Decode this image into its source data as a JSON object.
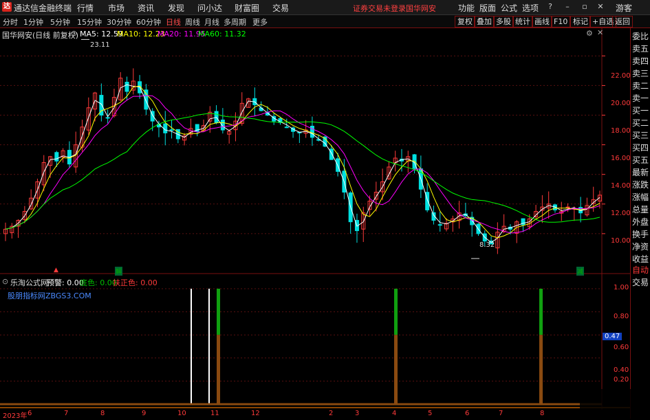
{
  "menubar": {
    "app_title": "通达信金融终端",
    "items": [
      "行情",
      "市场",
      "资讯",
      "发现",
      "问小达",
      "财富圈",
      "交易"
    ],
    "warning": "证券交易未登录",
    "stock": "国华网安",
    "right_items": [
      "功能",
      "版面",
      "公式",
      "选项"
    ],
    "guest": "游客"
  },
  "periodbar": {
    "periods": [
      "分时",
      "1分钟",
      "5分钟",
      "15分钟",
      "30分钟",
      "60分钟",
      "日线",
      "周线",
      "月线",
      "多周期",
      "更多"
    ],
    "active": "日线",
    "tools": [
      "复权",
      "叠加",
      "多股",
      "统计",
      "画线",
      "F10",
      "标记",
      "+自选",
      "返回"
    ]
  },
  "main_chart": {
    "title": "国华网安(日线 前复权)",
    "ma5": "MA5: 12.59",
    "ma10": "MA10: 12.23",
    "ma20": "MA20: 11.95",
    "ma60": "MA60: 11.32",
    "high_label": "23.11",
    "low_label": "8.32",
    "marker_jie": "解",
    "marker_jian": "减"
  },
  "sub_chart": {
    "name": "乐淘公式网",
    "signal": "预警: 0.00",
    "bottom_color": "底色: 0.00",
    "support": "扶正色: 0.00",
    "source": "股朋指标网ZBGS3.COM",
    "current_value": "0.47"
  },
  "yaxis_main": [
    "22.00",
    "20.00",
    "18.00",
    "16.00",
    "14.00",
    "12.00",
    "10.00"
  ],
  "yaxis_sub": [
    "1.00",
    "0.80",
    "0.60",
    "0.40",
    "0.20"
  ],
  "xaxis": [
    "2023年",
    "6",
    "7",
    "8",
    "9",
    "10",
    "11",
    "12",
    "2",
    "3",
    "4",
    "5",
    "6",
    "7",
    "8"
  ],
  "sidepanel": [
    "委比",
    "卖五",
    "卖四",
    "卖三",
    "卖二",
    "卖一",
    "买一",
    "买二",
    "买三",
    "买四",
    "买五",
    "最新",
    "涨跌",
    "涨幅",
    "总量",
    "外盘",
    "换手",
    "净资",
    "收益"
  ],
  "sidepanel_bottom": [
    "自动",
    "交易"
  ],
  "colors": {
    "up": "#ff3a3a",
    "down": "#00e0e0",
    "ma5": "#ffffff",
    "ma10": "#ffff00",
    "ma20": "#ff00ff",
    "ma60": "#00ff00",
    "frame": "#7a1010"
  },
  "chart_data": {
    "type": "candlestick",
    "ylim": [
      8,
      23.5
    ],
    "highest": 23.11,
    "lowest": 8.32,
    "close_series": [
      10.3,
      10.5,
      10.9,
      11.5,
      12.4,
      13.5,
      14.8,
      15.2,
      14.9,
      15.6,
      14.7,
      16.0,
      17.2,
      18.5,
      19.5,
      18.0,
      17.8,
      19.2,
      20.5,
      19.6,
      20.3,
      19.5,
      18.4,
      17.6,
      17.2,
      16.8,
      17.0,
      16.4,
      16.6,
      17.1,
      16.9,
      17.3,
      18.2,
      17.5,
      17.0,
      16.9,
      17.6,
      18.8,
      19.1,
      18.7,
      18.3,
      18.0,
      17.6,
      17.5,
      17.2,
      16.9,
      16.8,
      17.0,
      16.5,
      16.3,
      15.9,
      15.0,
      14.2,
      12.8,
      10.8,
      10.2,
      11.4,
      12.2,
      12.8,
      13.5,
      14.5,
      15.1,
      14.9,
      15.2,
      14.4,
      13.0,
      11.6,
      10.9,
      10.6,
      10.7,
      11.0,
      11.4,
      11.2,
      10.6,
      10.0,
      9.5,
      9.3,
      10.1,
      10.5,
      10.3,
      10.8,
      10.6,
      11.0,
      11.5,
      11.8,
      12.0,
      11.6,
      11.5,
      11.8,
      11.7,
      11.4,
      11.9,
      12.3,
      12.6
    ],
    "signal_bars": [
      {
        "month": "11",
        "value": 1.0
      },
      {
        "month": "4",
        "value": 1.0
      },
      {
        "month": "8",
        "value": 1.0
      }
    ]
  }
}
